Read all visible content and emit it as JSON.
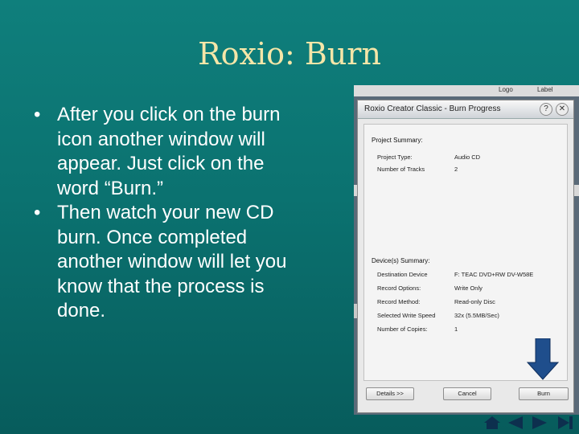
{
  "slide": {
    "title": "Roxio: Burn",
    "bullets": [
      "After you click on the burn icon another window will appear. Just click on the word “Burn.”",
      "Then watch your new CD burn.  Once completed another window will let you know that the process is done."
    ]
  },
  "background_app": {
    "toolbar_items": [
      "Logo",
      "Label"
    ]
  },
  "dialog": {
    "title": "Roxio Creator Classic - Burn Progress",
    "project_summary": {
      "heading": "Project Summary:",
      "rows": [
        {
          "label": "Project Type:",
          "value": "Audio CD"
        },
        {
          "label": "Number of Tracks",
          "value": "2"
        }
      ]
    },
    "device_summary": {
      "heading": "Device(s) Summary:",
      "rows": [
        {
          "label": "Destination Device",
          "value": "F: TEAC      DVD+RW DV-W58E"
        },
        {
          "label": "Record Options:",
          "value": "Write Only"
        },
        {
          "label": "Record Method:",
          "value": "Read-only Disc"
        },
        {
          "label": "Selected Write Speed",
          "value": "32x (5.5MB/Sec)"
        },
        {
          "label": "Number of Copies:",
          "value": "1"
        }
      ]
    },
    "buttons": {
      "details": "Details >>",
      "cancel": "Cancel",
      "burn": "Burn"
    }
  },
  "colors": {
    "background": "#0b7270",
    "title": "#f5e6a8",
    "arrow": "#1f4e8c"
  },
  "icons": [
    "help-icon",
    "close-icon",
    "down-arrow-icon",
    "home-icon",
    "previous-icon",
    "next-icon",
    "end-icon"
  ]
}
